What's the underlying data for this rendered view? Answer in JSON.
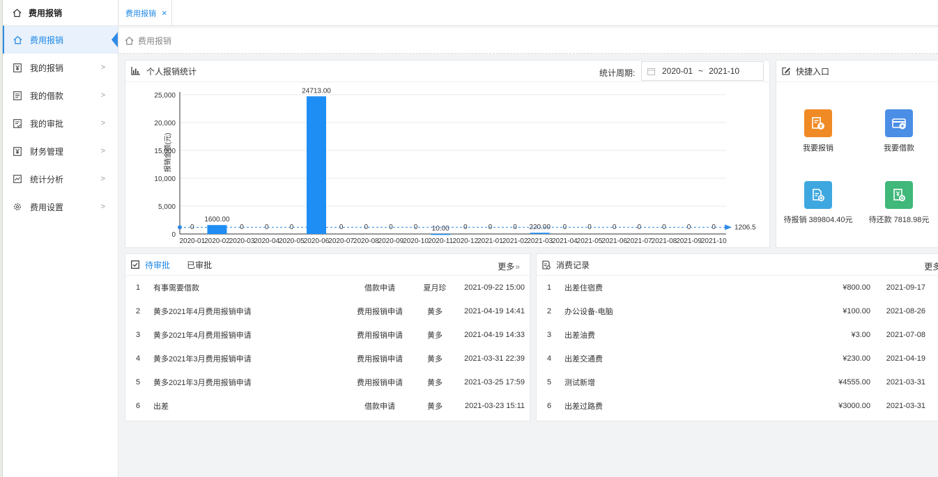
{
  "sidebar": {
    "header": "费用报销",
    "items": [
      {
        "label": "费用报销",
        "icon": "home-icon",
        "active": true
      },
      {
        "label": "我的报销",
        "icon": "yen-doc-icon"
      },
      {
        "label": "我的借款",
        "icon": "doc-icon"
      },
      {
        "label": "我的审批",
        "icon": "approve-doc-icon"
      },
      {
        "label": "财务管理",
        "icon": "yen-doc-icon"
      },
      {
        "label": "统计分析",
        "icon": "chart-icon"
      },
      {
        "label": "费用设置",
        "icon": "gear-icon"
      }
    ]
  },
  "tabs": [
    {
      "label": "费用报销",
      "close": "×"
    }
  ],
  "breadcrumb": {
    "label": "费用报销"
  },
  "stats": {
    "title": "个人报销统计",
    "period_label": "统计周期:",
    "period_start": "2020-01",
    "period_sep": "~",
    "period_end": "2021-10"
  },
  "chart_data": {
    "type": "bar",
    "ylabel": "报销金额(元)",
    "ylim": [
      0,
      25000
    ],
    "yticks": [
      "0",
      "5,000",
      "10,000",
      "15,000",
      "20,000",
      "25,000"
    ],
    "categories": [
      "2020-01",
      "2020-02",
      "2020-03",
      "2020-04",
      "2020-05",
      "2020-06",
      "2020-07",
      "2020-08",
      "2020-09",
      "2020-10",
      "2020-11",
      "2020-12",
      "2021-01",
      "2021-02",
      "2021-03",
      "2021-04",
      "2021-05",
      "2021-06",
      "2021-07",
      "2021-08",
      "2021-09",
      "2021-10"
    ],
    "values": [
      0,
      1600,
      0,
      0,
      0,
      24713,
      0,
      0,
      0,
      0,
      10,
      0,
      0,
      0,
      220,
      0,
      0,
      0,
      0,
      0,
      0,
      0
    ],
    "labels": [
      "0",
      "1600.00",
      "0",
      "0",
      "0",
      "24713.00",
      "0",
      "0",
      "0",
      "0",
      "10.00",
      "0",
      "0",
      "0",
      "220.00",
      "0",
      "0",
      "0",
      "0",
      "0",
      "0",
      "0"
    ],
    "avg_line": {
      "value": 1206.5,
      "label": "1206.5"
    },
    "bar_color": "#1e8ef5"
  },
  "quick": {
    "title": "快捷入口",
    "items": [
      {
        "label": "我要报销",
        "icon": "reimburse-icon",
        "color": "#f08a24"
      },
      {
        "label": "我要借款",
        "icon": "card-icon",
        "color": "#4a8ee6"
      },
      {
        "label": "待报销 389804.40元",
        "icon": "pending-reimburse-icon",
        "color": "#3fa7e0"
      },
      {
        "label": "待还款 7818.98元",
        "icon": "repay-icon",
        "color": "#3fb87a"
      }
    ]
  },
  "approvals": {
    "tab_pending": "待审批",
    "tab_done": "已审批",
    "more": "更多",
    "rows": [
      {
        "no": "1",
        "title": "有事需要借款",
        "type": "借款申请",
        "user": "夏月珍",
        "time": "2021-09-22 15:00"
      },
      {
        "no": "2",
        "title": "黄多2021年4月费用报销申请",
        "type": "费用报销申请",
        "user": "黄多",
        "time": "2021-04-19 14:41"
      },
      {
        "no": "3",
        "title": "黄多2021年4月费用报销申请",
        "type": "费用报销申请",
        "user": "黄多",
        "time": "2021-04-19 14:33"
      },
      {
        "no": "4",
        "title": "黄多2021年3月费用报销申请",
        "type": "费用报销申请",
        "user": "黄多",
        "time": "2021-03-31 22:39"
      },
      {
        "no": "5",
        "title": "黄多2021年3月费用报销申请",
        "type": "费用报销申请",
        "user": "黄多",
        "time": "2021-03-25 17:59"
      },
      {
        "no": "6",
        "title": "出差",
        "type": "借款申请",
        "user": "黄多",
        "time": "2021-03-23 15:11"
      }
    ]
  },
  "consumption": {
    "title": "消费记录",
    "more": "更多",
    "rows": [
      {
        "no": "1",
        "title": "出差住宿费",
        "amount": "¥800.00",
        "date": "2021-09-17"
      },
      {
        "no": "2",
        "title": "办公设备-电脑",
        "amount": "¥100.00",
        "date": "2021-08-26"
      },
      {
        "no": "3",
        "title": "出差油费",
        "amount": "¥3.00",
        "date": "2021-07-08"
      },
      {
        "no": "4",
        "title": "出差交通费",
        "amount": "¥230.00",
        "date": "2021-04-19"
      },
      {
        "no": "5",
        "title": "测试新增",
        "amount": "¥4555.00",
        "date": "2021-03-31"
      },
      {
        "no": "6",
        "title": "出差过路费",
        "amount": "¥3000.00",
        "date": "2021-03-31"
      }
    ]
  }
}
